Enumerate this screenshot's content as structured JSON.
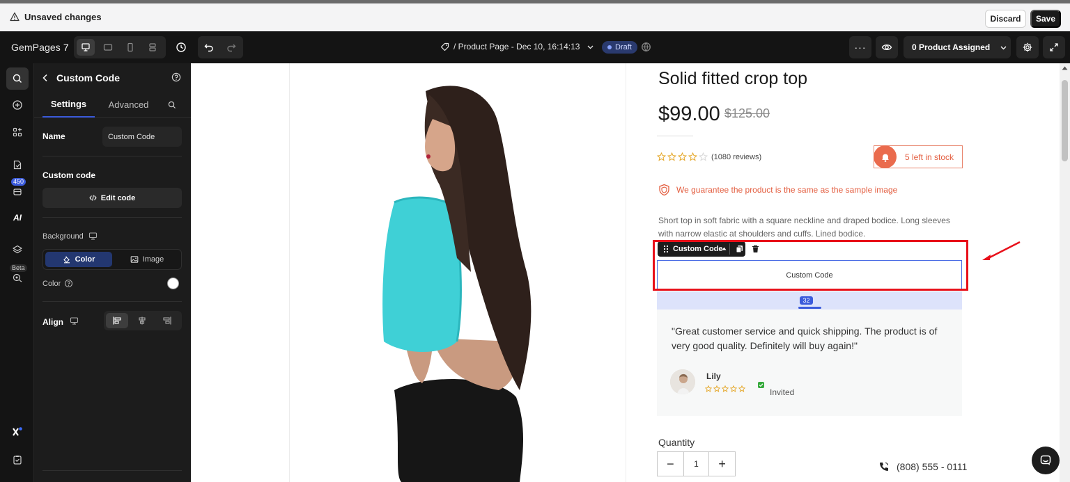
{
  "unsaved_bar": {
    "message": "Unsaved changes",
    "discard_label": "Discard",
    "save_label": "Save"
  },
  "toolbar": {
    "app_name": "GemPages",
    "app_version": "7",
    "page_title": "/ Product Page - Dec 10, 16:14:13",
    "status": "Draft",
    "products_assigned": "0 Product Assigned",
    "more_label": "···"
  },
  "rail": {
    "badge_count": "450",
    "beta_label": "Beta",
    "ai_label": "AI"
  },
  "panel": {
    "title": "Custom Code",
    "tabs": [
      "Settings",
      "Advanced"
    ],
    "name_label": "Name",
    "name_value": "Custom Code",
    "custom_code_label": "Custom code",
    "edit_code_label": "Edit code",
    "background_label": "Background",
    "bg_options": [
      "Color",
      "Image"
    ],
    "color_label": "Color",
    "align_label": "Align"
  },
  "product": {
    "title": "Solid fitted crop top",
    "price": "$99.00",
    "compare_price": "$125.00",
    "reviews": "(1080 reviews)",
    "rating": 4,
    "stock": "5 left in stock",
    "guarantee": "We guarantee the product is the same as the sample image",
    "description": "Short top in soft fabric with a square neckline and draped bodice. Long sleeves with narrow elastic at shoulders and cuffs. Lined bodice.",
    "custom_code_toolbar_label": "Custom Code",
    "custom_code_box": "Custom Code",
    "spacing_value": "32",
    "testimonial_quote": "\"Great customer service and quick shipping. The product is of very good quality. Definitely will buy again!\"",
    "testimonial_author": "Lily",
    "testimonial_status": "Invited",
    "quantity_label": "Quantity",
    "quantity_value": "1",
    "qty_minus": "−",
    "qty_plus": "+",
    "phone": "(808) 555 - 0111"
  },
  "colors": {
    "accent": "#3b5bdb",
    "stock": "#e35d3f",
    "highlight_frame": "#e8101a",
    "draft": "#2a3a6e"
  }
}
